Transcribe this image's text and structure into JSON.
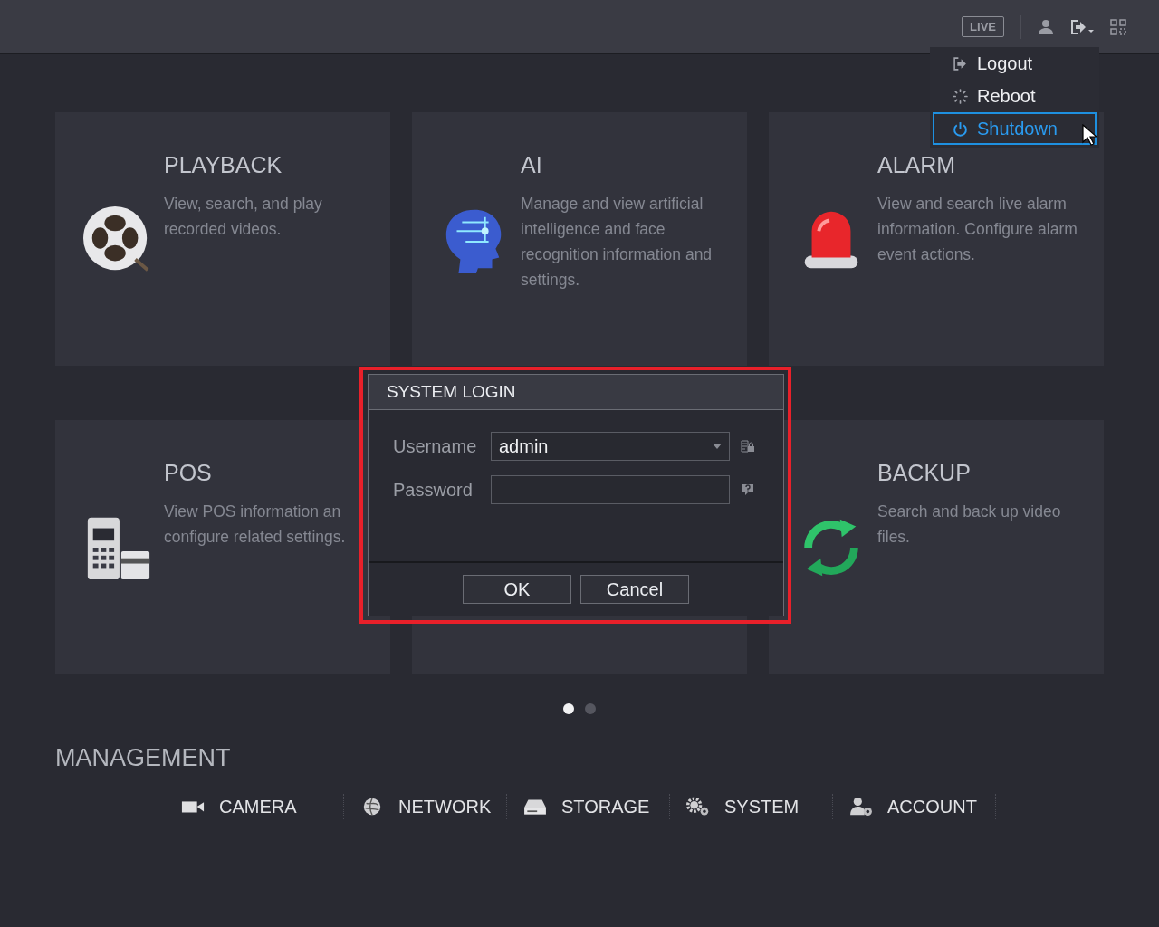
{
  "top_bar": {
    "live_button": "LIVE"
  },
  "user_menu": {
    "items": [
      {
        "label": "Logout",
        "kind": "logout",
        "selected": false
      },
      {
        "label": "Reboot",
        "kind": "reboot",
        "selected": false
      },
      {
        "label": "Shutdown",
        "kind": "shutdown",
        "selected": true
      }
    ]
  },
  "tiles": [
    {
      "kind": "playback",
      "title": "PLAYBACK",
      "description": "View, search, and play recorded videos."
    },
    {
      "kind": "ai",
      "title": "AI",
      "description": "Manage and view artificial intelligence and face recognition information and settings."
    },
    {
      "kind": "alarm",
      "title": "ALARM",
      "description": "View and search live alarm information. Configure alarm event actions."
    },
    {
      "kind": "pos",
      "title": "POS",
      "description": "View POS information an configure related settings."
    },
    {
      "kind": "hidden"
    },
    {
      "kind": "backup",
      "title": "BACKUP",
      "description": "Search and back up video files."
    }
  ],
  "login_dialog": {
    "title": "SYSTEM LOGIN",
    "fields": [
      {
        "kind": "dropdown",
        "label": "Username",
        "value": "admin"
      },
      {
        "kind": "password",
        "label": "Password"
      }
    ],
    "buttons": [
      "OK",
      "Cancel"
    ]
  },
  "pagination": [
    {
      "selected": true
    },
    {
      "selected": false
    }
  ],
  "management": {
    "title": "MANAGEMENT",
    "items": [
      {
        "kind": "camera",
        "label": "CAMERA"
      },
      {
        "kind": "network",
        "label": "NETWORK"
      },
      {
        "kind": "storage",
        "label": "STORAGE"
      },
      {
        "kind": "system",
        "label": "SYSTEM"
      },
      {
        "kind": "account",
        "label": "ACCOUNT"
      }
    ]
  }
}
